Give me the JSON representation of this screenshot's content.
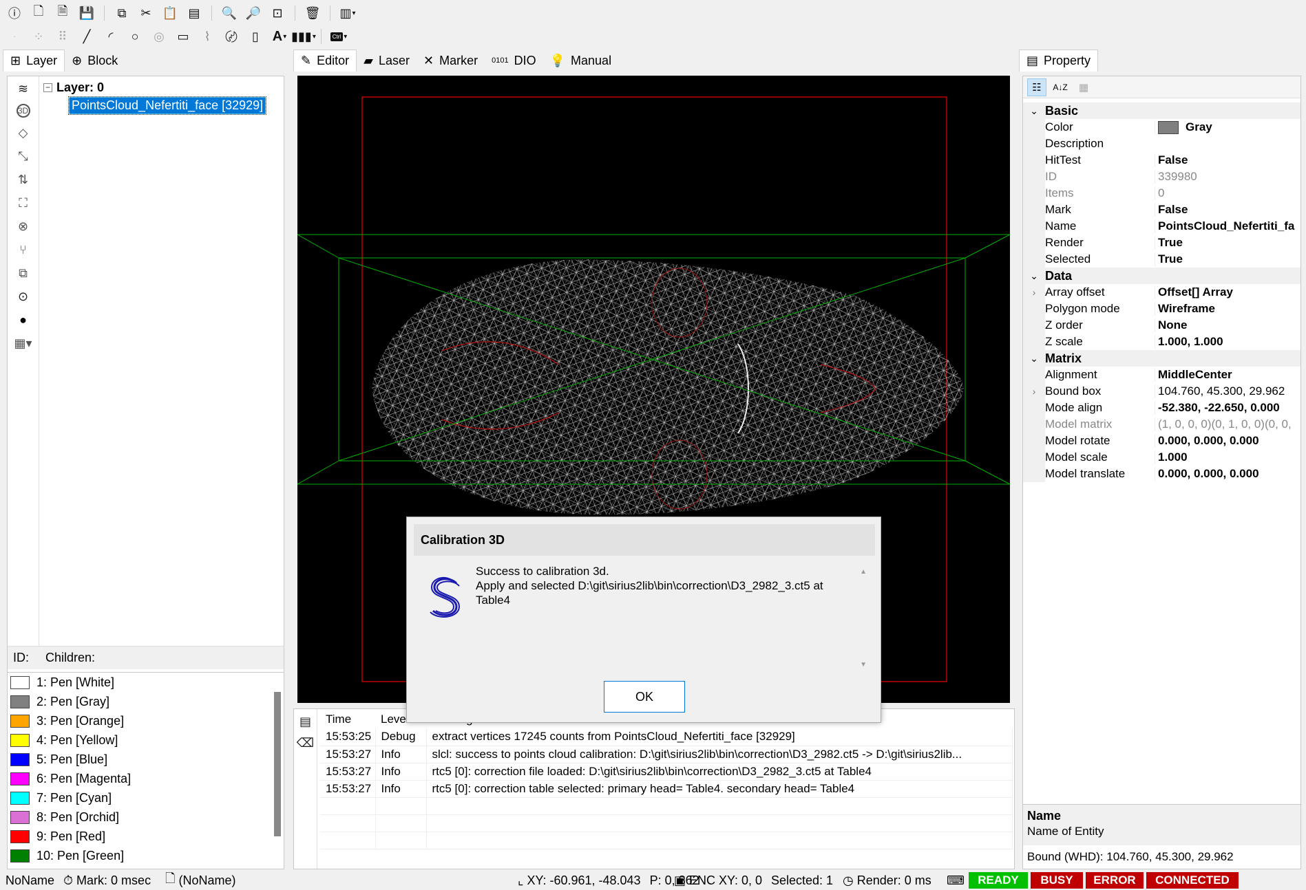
{
  "toolbar_top": {
    "icons": [
      "info-icon",
      "new-file-icon",
      "new-file-plus-icon",
      "save-icon",
      "copy-icon",
      "cut-icon",
      "paste-icon",
      "clipboard-icon",
      "zoom-out-icon",
      "zoom-in-icon",
      "zoom-fit-icon",
      "delete-icon",
      "align-dropdown-icon"
    ]
  },
  "toolbar_draw": {
    "icons": [
      "point-icon",
      "points-icon",
      "grid-points-icon",
      "line-icon",
      "arc-icon",
      "circle-icon",
      "trepan-icon",
      "rectangle-icon",
      "polyline-icon",
      "spiral-icon",
      "file-icon",
      "text-icon",
      "barcode-icon",
      "ctrl-icon"
    ]
  },
  "left_tabs": [
    {
      "label": "Layer",
      "icon": "layer-tree-icon"
    },
    {
      "label": "Block",
      "icon": "block-icon"
    }
  ],
  "center_tabs": [
    {
      "label": "Editor",
      "icon": "editor-icon"
    },
    {
      "label": "Laser",
      "icon": "laser-icon"
    },
    {
      "label": "Marker",
      "icon": "marker-icon"
    },
    {
      "label": "DIO",
      "icon": "dio-icon"
    },
    {
      "label": "Manual",
      "icon": "manual-bulb-icon"
    }
  ],
  "right_tabs": [
    {
      "label": "Property",
      "icon": "property-icon"
    }
  ],
  "tree": {
    "root": "Layer: 0",
    "child": "PointsCloud_Nefertiti_face [32929]"
  },
  "left_info": {
    "id_label": "ID:",
    "children_label": "Children:"
  },
  "pens": [
    {
      "label": "1: Pen [White]",
      "color": "#ffffff"
    },
    {
      "label": "2: Pen [Gray]",
      "color": "#808080"
    },
    {
      "label": "3: Pen [Orange]",
      "color": "#ffa500"
    },
    {
      "label": "4: Pen [Yellow]",
      "color": "#ffff00"
    },
    {
      "label": "5: Pen [Blue]",
      "color": "#0000ff"
    },
    {
      "label": "6: Pen [Magenta]",
      "color": "#ff00ff"
    },
    {
      "label": "7: Pen [Cyan]",
      "color": "#00ffff"
    },
    {
      "label": "8: Pen [Orchid]",
      "color": "#da70d6"
    },
    {
      "label": "9: Pen [Red]",
      "color": "#ff0000"
    },
    {
      "label": "10: Pen [Green]",
      "color": "#008000"
    }
  ],
  "log": {
    "headers": [
      "Time",
      "Level",
      "Message"
    ],
    "rows": [
      {
        "time": "15:53:25",
        "level": "Debug",
        "message": "extract vertices 17245 counts from PointsCloud_Nefertiti_face [32929]"
      },
      {
        "time": "15:53:27",
        "level": "Info",
        "message": "slcl: success to points cloud calibration: D:\\git\\sirius2lib\\bin\\correction\\D3_2982.ct5 -> D:\\git\\sirius2lib..."
      },
      {
        "time": "15:53:27",
        "level": "Info",
        "message": "rtc5 [0]: correction file loaded: D:\\git\\sirius2lib\\bin\\correction\\D3_2982_3.ct5 at Table4"
      },
      {
        "time": "15:53:27",
        "level": "Info",
        "message": "rtc5 [0]: correction table selected: primary head= Table4. secondary head= Table4"
      }
    ]
  },
  "property": {
    "categories": [
      {
        "name": "Basic",
        "rows": [
          {
            "key": "Color",
            "value": "Gray",
            "swatch": "#808080"
          },
          {
            "key": "Description",
            "value": ""
          },
          {
            "key": "HitTest",
            "value": "False"
          },
          {
            "key": "ID",
            "value": "339980",
            "dim": true
          },
          {
            "key": "Items",
            "value": "0",
            "dim": true
          },
          {
            "key": "Mark",
            "value": "False"
          },
          {
            "key": "Name",
            "value": "PointsCloud_Nefertiti_fa"
          },
          {
            "key": "Render",
            "value": "True"
          },
          {
            "key": "Selected",
            "value": "True"
          }
        ]
      },
      {
        "name": "Data",
        "rows": [
          {
            "key": "Array offset",
            "value": "Offset[] Array",
            "expand": true
          },
          {
            "key": "Polygon mode",
            "value": "Wireframe"
          },
          {
            "key": "Z order",
            "value": "None"
          },
          {
            "key": "Z scale",
            "value": "1.000, 1.000"
          }
        ]
      },
      {
        "name": "Matrix",
        "rows": [
          {
            "key": "Alignment",
            "value": "MiddleCenter"
          },
          {
            "key": "Bound box",
            "value": "104.760, 45.300, 29.962",
            "expand": true,
            "normal": true
          },
          {
            "key": "Mode align",
            "value": "-52.380, -22.650, 0.000"
          },
          {
            "key": "Model matrix",
            "value": "(1, 0, 0, 0)(0, 1, 0, 0)(0, 0,",
            "dim": true
          },
          {
            "key": "Model rotate",
            "value": "0.000, 0.000, 0.000"
          },
          {
            "key": "Model scale",
            "value": "1.000"
          },
          {
            "key": "Model translate",
            "value": "0.000, 0.000, 0.000"
          }
        ]
      }
    ],
    "desc_name": "Name",
    "desc_text": "Name of Entity",
    "bound": "Bound (WHD): 104.760, 45.300, 29.962"
  },
  "dialog": {
    "title": "Calibration 3D",
    "line1": "Success to calibration 3d.",
    "line2": "Apply and selected D:\\git\\sirius2lib\\bin\\correction\\D3_2982_3.ct5 at",
    "line3": "Table4",
    "ok": "OK"
  },
  "status": {
    "doc": "NoName",
    "mark": "Mark: 0 msec",
    "file": "(NoName)",
    "xy": "XY: -60.961, -48.043",
    "p": "P: 0, 862",
    "enc": "ENC XY: 0, 0",
    "selected": "Selected: 1",
    "render": "Render: 0 ms",
    "ready": "READY",
    "busy": "BUSY",
    "error": "ERROR",
    "connected": "CONNECTED",
    "colors": {
      "ready": "#00c000",
      "busy": "#c00000",
      "error": "#c00000",
      "connected": "#c00000"
    }
  }
}
